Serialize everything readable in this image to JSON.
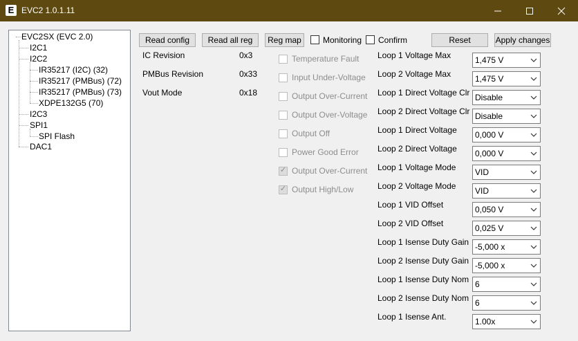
{
  "window": {
    "title": "EVC2 1.0.1.11",
    "icon_letter": "E"
  },
  "tree": [
    {
      "label": "EVC2SX (EVC 2.0)"
    },
    {
      "label": "I2C1"
    },
    {
      "label": "I2C2"
    },
    {
      "label": "IR35217 (I2C) (32)"
    },
    {
      "label": "IR35217 (PMBus) (72)"
    },
    {
      "label": "IR35217 (PMBus) (73)"
    },
    {
      "label": "XDPE132G5 (70)"
    },
    {
      "label": "I2C3"
    },
    {
      "label": "SPI1"
    },
    {
      "label": "SPI Flash"
    },
    {
      "label": "DAC1"
    }
  ],
  "toolbar": {
    "read_config": "Read config",
    "read_all_reg": "Read all reg",
    "reg_map": "Reg map",
    "monitoring": "Monitoring",
    "confirm": "Confirm",
    "reset": "Reset",
    "apply_changes": "Apply changes"
  },
  "info": [
    {
      "label": "IC Revision",
      "value": "0x3"
    },
    {
      "label": "PMBus Revision",
      "value": "0x33"
    },
    {
      "label": "Vout Mode",
      "value": "0x18"
    }
  ],
  "status_flags": [
    {
      "label": "Temperature Fault",
      "checked": false
    },
    {
      "label": "Input Under-Voltage",
      "checked": false
    },
    {
      "label": "Output Over-Current",
      "checked": false
    },
    {
      "label": "Output Over-Voltage",
      "checked": false
    },
    {
      "label": "Output Off",
      "checked": false
    },
    {
      "label": "Power Good Error",
      "checked": false
    },
    {
      "label": "Output Over-Current",
      "checked": true
    },
    {
      "label": "Output High/Low",
      "checked": true
    }
  ],
  "settings": [
    {
      "label": "Loop 1 Voltage Max",
      "value": "1,475 V"
    },
    {
      "label": "Loop 2 Voltage Max",
      "value": "1,475 V"
    },
    {
      "label": "Loop 1 Direct Voltage Clr",
      "value": "Disable"
    },
    {
      "label": "Loop 2 Direct Voltage Clr",
      "value": "Disable"
    },
    {
      "label": "Loop 1 Direct Voltage",
      "value": "0,000 V"
    },
    {
      "label": "Loop 2 Direct Voltage",
      "value": "0,000 V"
    },
    {
      "label": "Loop 1 Voltage Mode",
      "value": "VID"
    },
    {
      "label": "Loop 2 Voltage Mode",
      "value": "VID"
    },
    {
      "label": "Loop 1 VID Offset",
      "value": "0,050 V"
    },
    {
      "label": "Loop 2 VID Offset",
      "value": "0,025 V"
    },
    {
      "label": "Loop 1 Isense Duty Gain",
      "value": "-5,000 x"
    },
    {
      "label": "Loop 2 Isense Duty Gain",
      "value": "-5,000 x"
    },
    {
      "label": "Loop 1 Isense Duty Nom",
      "value": "6"
    },
    {
      "label": "Loop 2 Isense Duty Nom",
      "value": "6"
    },
    {
      "label": "Loop 1 Isense Ant.",
      "value": "1.00x"
    }
  ]
}
